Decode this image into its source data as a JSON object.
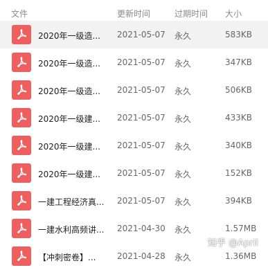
{
  "header": {
    "name": "文件",
    "updated": "更新时间",
    "expiry": "过期时间",
    "size": "大小"
  },
  "files": [
    {
      "name": "2020年一级造...",
      "updated": "2021-05-07",
      "expiry": "永久",
      "size": "583KB",
      "selected": true
    },
    {
      "name": "2020年一级造...",
      "updated": "2021-05-07",
      "expiry": "永久",
      "size": "347KB"
    },
    {
      "name": "2020年一级造...",
      "updated": "2021-05-07",
      "expiry": "永久",
      "size": "506KB"
    },
    {
      "name": "2020年一级建...",
      "updated": "2021-05-07",
      "expiry": "永久",
      "size": "433KB"
    },
    {
      "name": "2020年一级建...",
      "updated": "2021-05-07",
      "expiry": "永久",
      "size": "340KB"
    },
    {
      "name": "2020年一级建...",
      "updated": "2021-05-07",
      "expiry": "永久",
      "size": "152KB"
    },
    {
      "name": "一建工程经济真...",
      "updated": "2021-05-07",
      "expiry": "永久",
      "size": "394KB"
    },
    {
      "name": "一建水利高频讲...",
      "updated": "2021-04-30",
      "expiry": "永久",
      "size": "1.57MB"
    },
    {
      "name": "【冲刺密卷】...",
      "updated": "2021-04-28",
      "expiry": "永久",
      "size": "1.36MB"
    }
  ],
  "icon": {
    "name": "pdf-icon",
    "color": "#ee5f5f"
  },
  "watermark": "知乎 @April"
}
